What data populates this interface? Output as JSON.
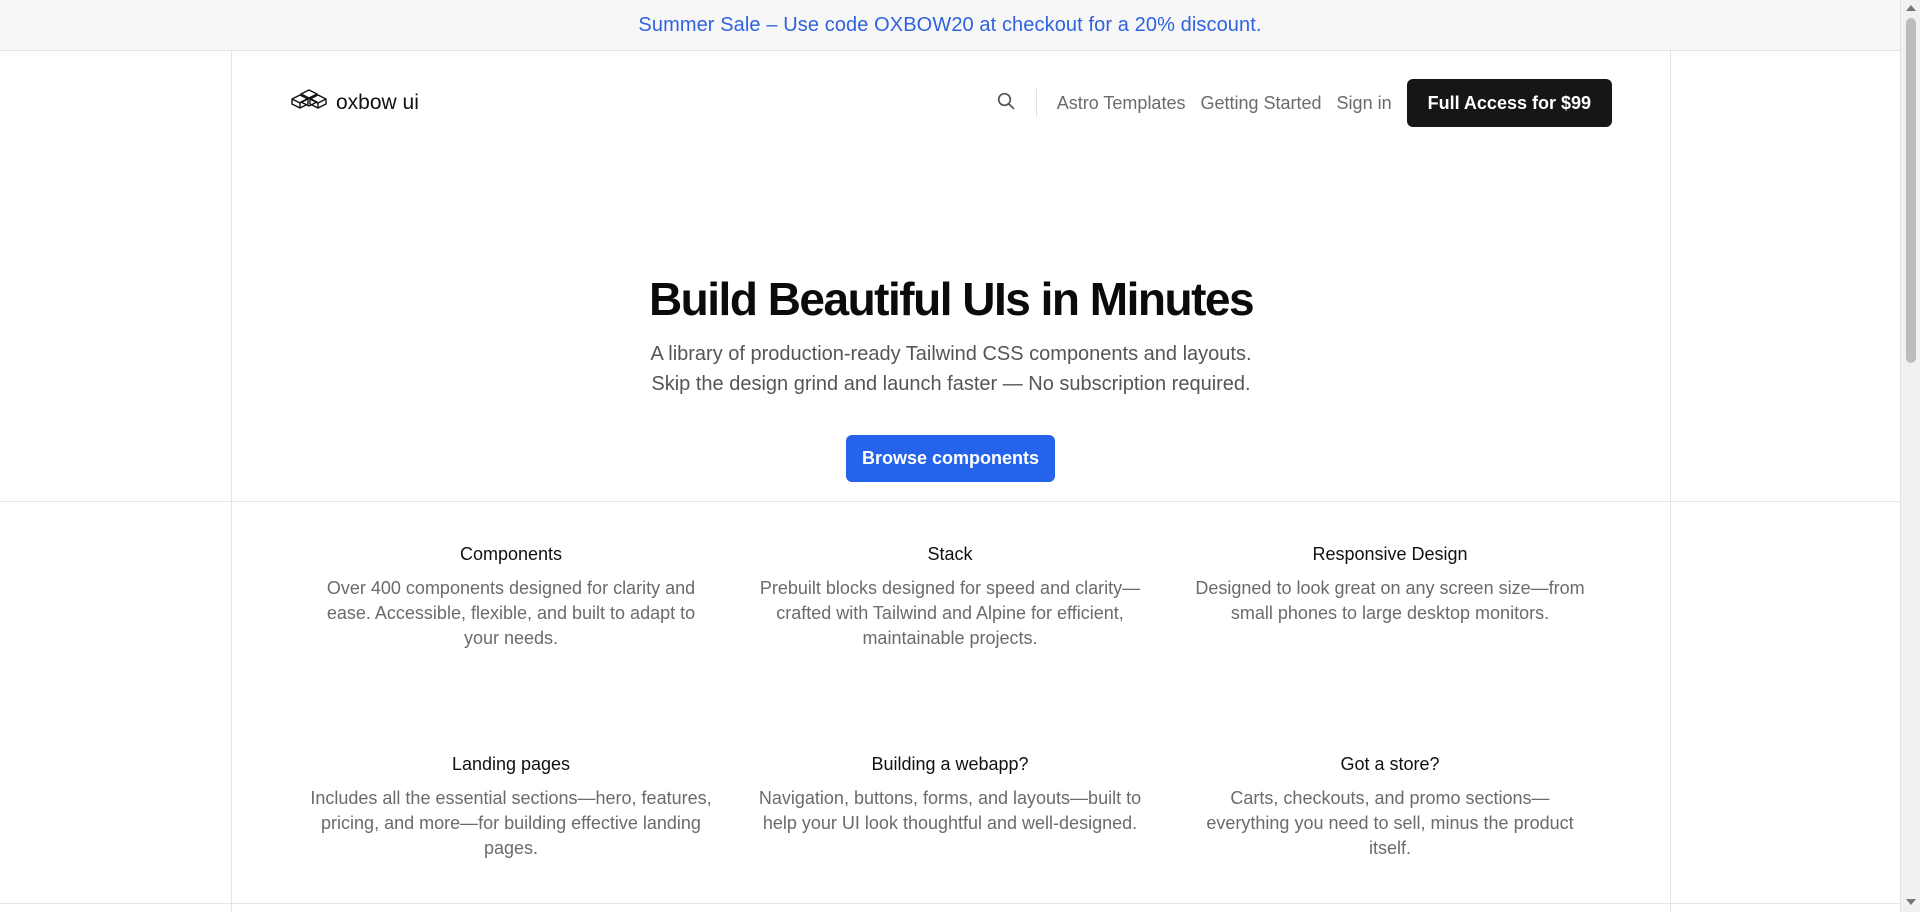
{
  "banner": {
    "text": "Summer Sale – Use code OXBOW20 at checkout for a 20% discount."
  },
  "header": {
    "logo_text": "oxbow ui",
    "nav": [
      {
        "label": "Astro Templates"
      },
      {
        "label": "Getting Started"
      },
      {
        "label": "Sign in"
      }
    ],
    "cta_label": "Full Access for $99"
  },
  "hero": {
    "title": "Build Beautiful UIs in Minutes",
    "subtitle_line1": "A library of production-ready Tailwind CSS components and layouts.",
    "subtitle_line2": "Skip the design grind and launch faster — No subscription required.",
    "button_label": "Browse components"
  },
  "features": [
    {
      "title": "Components",
      "desc": "Over 400 components designed for clarity and ease. Accessible, flexible, and built to adapt to your needs."
    },
    {
      "title": "Stack",
      "desc": "Prebuilt blocks designed for speed and clarity—crafted with Tailwind and Alpine for efficient, maintainable projects."
    },
    {
      "title": "Responsive Design",
      "desc": "Designed to look great on any screen size—from small phones to large desktop monitors."
    },
    {
      "title": "Landing pages",
      "desc": "Includes all the essential sections—hero, features, pricing, and more—for building effective landing pages."
    },
    {
      "title": "Building a webapp?",
      "desc": "Navigation, buttons, forms, and layouts—built to help your UI look thoughtful and well-designed."
    },
    {
      "title": "Got a store?",
      "desc": "Carts, checkouts, and promo sections—everything you need to sell, minus the product itself."
    }
  ],
  "colors": {
    "banner_text": "#2f62df",
    "primary_button": "#2563eb",
    "dark_button": "#161616"
  },
  "icons": {
    "logo": "box-stack-logo-icon",
    "search": "search-icon"
  }
}
